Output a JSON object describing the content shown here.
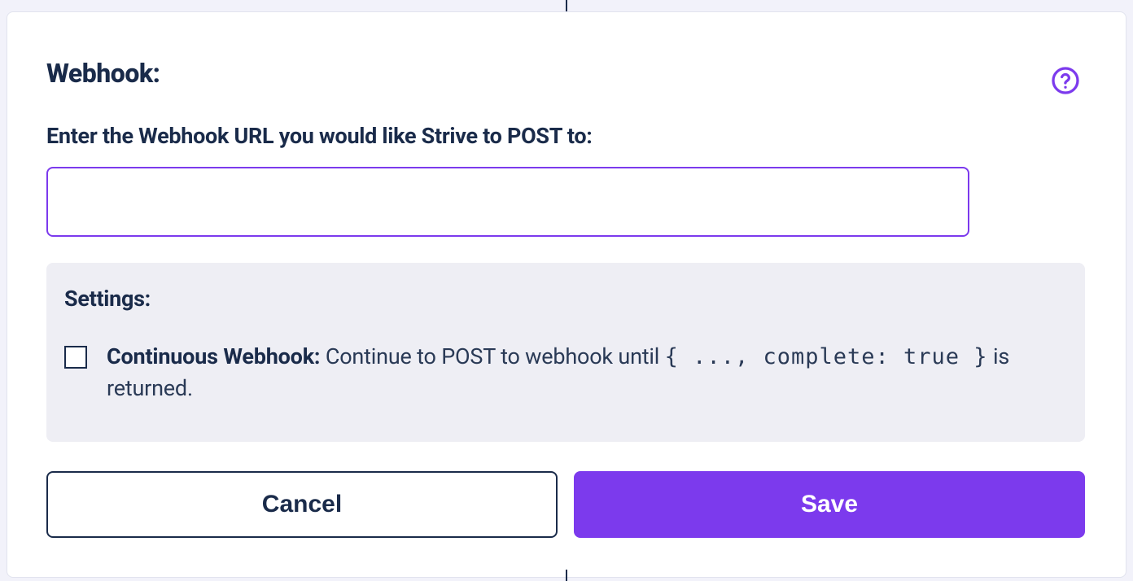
{
  "card": {
    "title": "Webhook:",
    "help_icon_name": "help-circle-icon"
  },
  "url_field": {
    "label": "Enter the Webhook URL you would like Strive to POST to:",
    "value": ""
  },
  "settings": {
    "title": "Settings:",
    "continuous": {
      "checked": false,
      "label_bold": "Continuous Webhook:",
      "label_text_before": " Continue to POST to webhook until ",
      "label_code": "{ ..., complete: true }",
      "label_text_after": " is returned."
    }
  },
  "buttons": {
    "cancel": "Cancel",
    "save": "Save"
  },
  "colors": {
    "accent": "#7C3AED",
    "text": "#1a2b4a",
    "panel_bg": "#eeeef4",
    "page_bg": "#f2f2fa"
  }
}
